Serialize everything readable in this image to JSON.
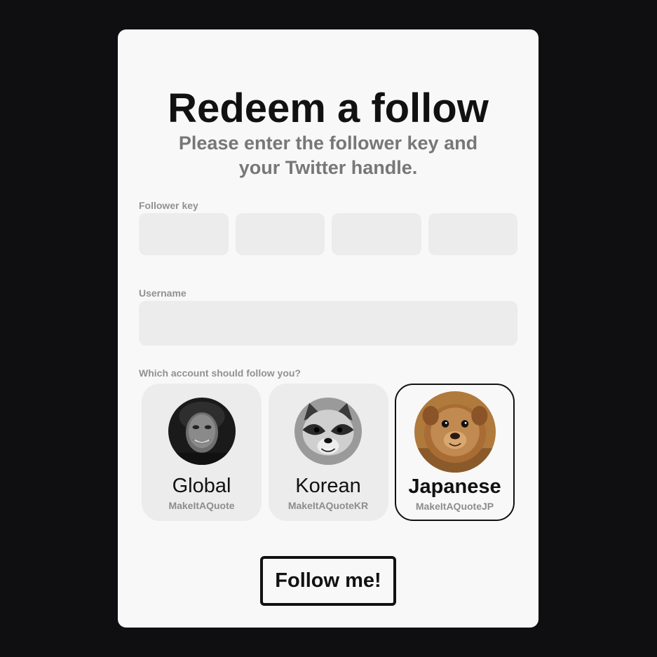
{
  "form": {
    "title": "Redeem a follow",
    "subtitle": "Please enter the follower key and your Twitter handle.",
    "follower_key_label": "Follower key",
    "follower_key_fields": [
      {
        "value": "",
        "placeholder": ""
      },
      {
        "value": "",
        "placeholder": ""
      },
      {
        "value": "",
        "placeholder": ""
      },
      {
        "value": "",
        "placeholder": ""
      }
    ],
    "username_label": "Username",
    "username": {
      "value": "",
      "placeholder": ""
    },
    "account_question": "Which account should follow you?",
    "accounts": [
      {
        "name": "Global",
        "handle": "MakeItAQuote",
        "avatar_icon": "joker-avatar-icon",
        "selected": false
      },
      {
        "name": "Korean",
        "handle": "MakeItAQuoteKR",
        "avatar_icon": "raccoon-avatar-icon",
        "selected": false
      },
      {
        "name": "Japanese",
        "handle": "MakeItAQuoteJP",
        "avatar_icon": "quokka-avatar-icon",
        "selected": true
      }
    ],
    "submit_label": "Follow me!"
  },
  "colors": {
    "page_background": "#0f0f11",
    "card_background": "#f8f8f8",
    "input_background": "#ececec",
    "text_primary": "#111111",
    "text_secondary": "#777777"
  }
}
